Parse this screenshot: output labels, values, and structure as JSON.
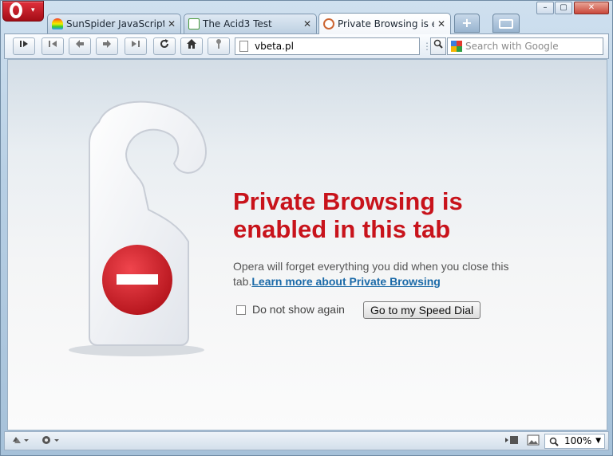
{
  "window": {
    "min": "–",
    "max": "▢",
    "close": "✕"
  },
  "tabs": [
    {
      "title": "SunSpider JavaScript ...",
      "icon": "rainbow-icon",
      "close": "✕"
    },
    {
      "title": "The Acid3 Test",
      "icon": "document-icon",
      "close": "✕"
    },
    {
      "title": "Private Browsing is e...",
      "icon": "private-browsing-icon",
      "close": "✕"
    }
  ],
  "new_tab": "+",
  "toolbar": {
    "address": "vbeta.pl",
    "search_placeholder": "Search with Google",
    "grip": "⋮"
  },
  "page": {
    "heading": "Private Browsing is enabled in this tab",
    "description": "Opera will forget everything you did when you close this tab.",
    "learn_more": "Learn more about Private Browsing",
    "checkbox_label": "Do not show again",
    "speed_dial_button": "Go to my Speed Dial"
  },
  "status": {
    "zoom": "100%"
  },
  "colors": {
    "heading": "#c8131b",
    "link": "#1b6aa8",
    "accent": "#c11a22"
  }
}
